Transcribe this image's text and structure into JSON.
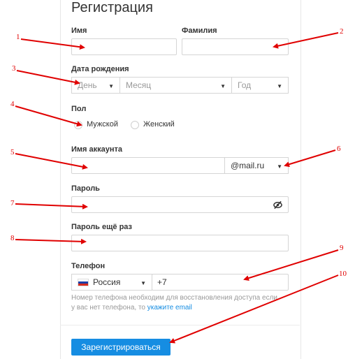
{
  "form": {
    "title": "Регистрация",
    "first_name_label": "Имя",
    "last_name_label": "Фамилия",
    "birth_label": "Дата рождения",
    "day_placeholder": "День",
    "month_placeholder": "Месяц",
    "year_placeholder": "Год",
    "gender_label": "Пол",
    "gender_male": "Мужской",
    "gender_female": "Женский",
    "account_label": "Имя аккаунта",
    "domain_value": "@mail.ru",
    "password_label": "Пароль",
    "password_repeat_label": "Пароль ещё раз",
    "phone_label": "Телефон",
    "country_value": "Россия",
    "phone_prefix": "+7",
    "hint_text": "Номер телефона необходим для восстановления доступа если у вас нет телефона, то ",
    "hint_link": "укажите email",
    "submit_label": "Зарегистрироваться"
  },
  "annotations": [
    "1",
    "2",
    "3",
    "4",
    "5",
    "6",
    "7",
    "8",
    "9",
    "10"
  ],
  "colors": {
    "arrow": "#e00000",
    "button": "#168de2",
    "link": "#168de2"
  },
  "icons": {
    "password_toggle": "eye-slash-icon",
    "country_flag": "russia-flag-icon"
  }
}
